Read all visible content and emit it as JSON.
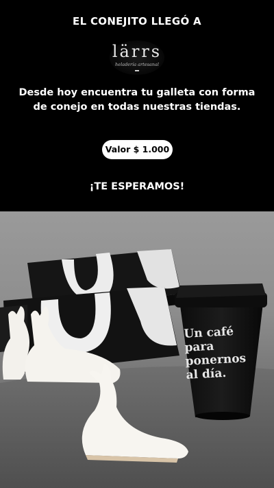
{
  "banner": {
    "headline": "EL CONEJITO LLEGÓ A",
    "logo": {
      "wordmark": "lärrs",
      "subtitle": "heladería artesanal"
    },
    "tagline": "Desde hoy encuentra tu galleta con forma de conejo en todas nuestras tiendas.",
    "price_button": "Valor $ 1.000",
    "cta": "¡TE ESPERAMOS!"
  },
  "photo": {
    "cup_text": "Un café\npara\nponernos\nal día."
  },
  "colors": {
    "banner_bg": "#000000",
    "text": "#ffffff",
    "button_bg": "#ffffff",
    "button_text": "#000000"
  }
}
